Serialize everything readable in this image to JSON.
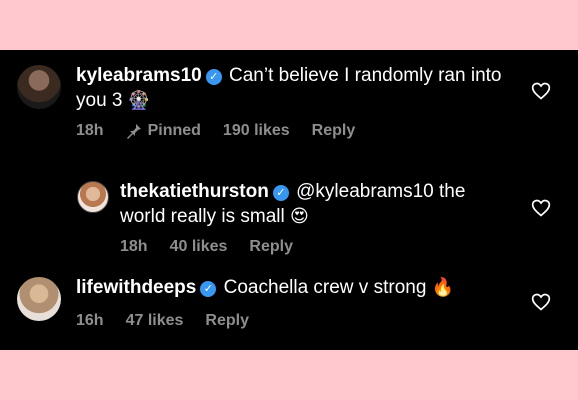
{
  "comments": [
    {
      "username": "kyleabrams10",
      "text": "Can’t believe I randomly ran into you 3",
      "emoji": "🎡",
      "time": "18h",
      "pinned": "Pinned",
      "likes": "190 likes",
      "reply": "Reply"
    },
    {
      "username": "thekatiethurston",
      "mention": "@kyleabrams10",
      "text": " the world really is small",
      "emoji": "😍",
      "time": "18h",
      "likes": "40 likes",
      "reply": "Reply"
    },
    {
      "username": "lifewithdeeps",
      "text": "Coachella crew v strong",
      "emoji": "🔥",
      "time": "16h",
      "likes": "47 likes",
      "reply": "Reply"
    }
  ],
  "icons": {
    "verified": "verified-badge-icon",
    "heart": "heart-outline-icon",
    "pin": "pin-icon"
  },
  "colors": {
    "background": "#000000",
    "border": "#ffc8cf",
    "text": "#ffffff",
    "meta": "#8e8e8e",
    "verified": "#3897f0"
  }
}
